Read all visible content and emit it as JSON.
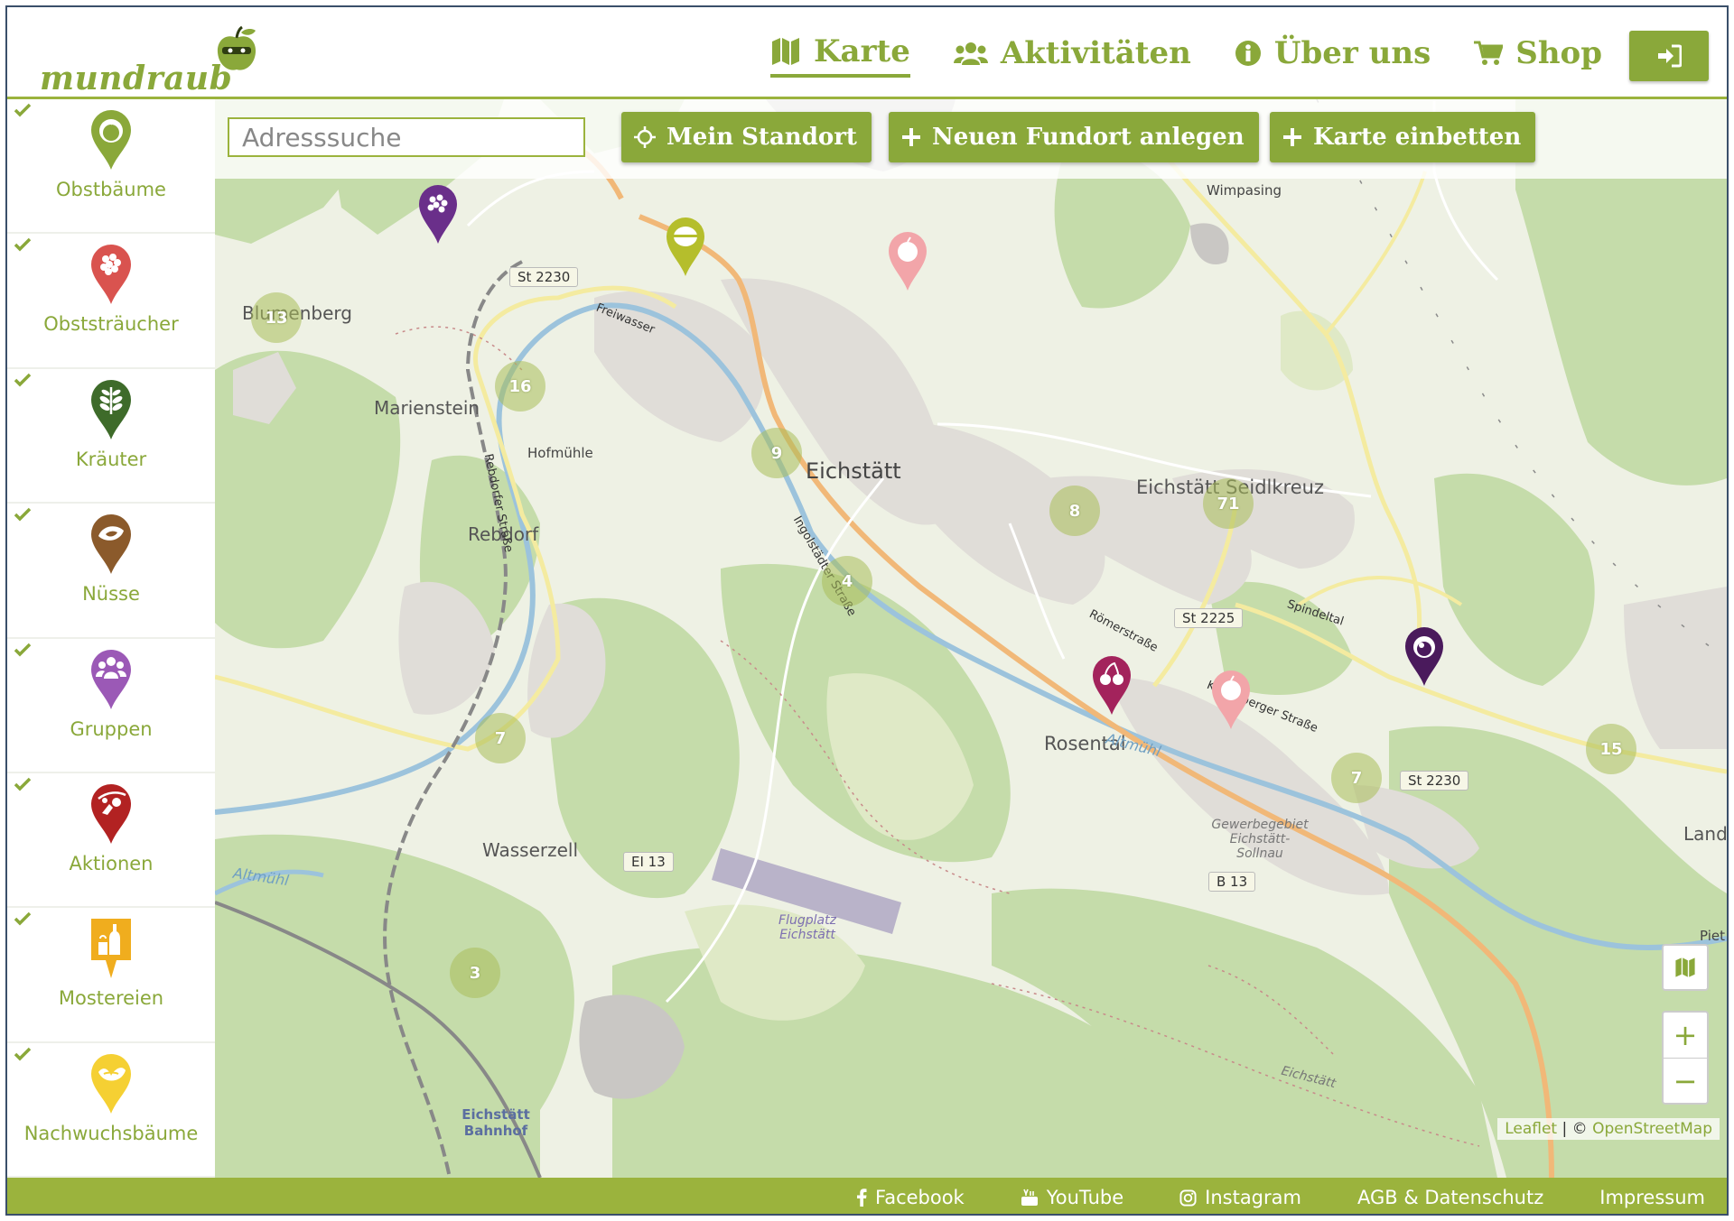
{
  "brand": {
    "name": "mundraub",
    "color": "#8aa83a"
  },
  "nav": {
    "items": [
      {
        "label": "Karte",
        "icon": "map-icon",
        "active": true
      },
      {
        "label": "Aktivitäten",
        "icon": "users-icon",
        "active": false
      },
      {
        "label": "Über uns",
        "icon": "info-icon",
        "active": false
      },
      {
        "label": "Shop",
        "icon": "cart-icon",
        "active": false
      }
    ],
    "login_icon": "sign-in-icon"
  },
  "toolbar": {
    "search_placeholder": "Adresssuche",
    "location_button": "Mein Standort",
    "new_site_button": "Neuen Fundort anlegen",
    "embed_button": "Karte einbetten"
  },
  "sidebar": {
    "categories": [
      {
        "label": "Obstbäume",
        "color": "#8aa83a",
        "icon": "apple-tree-icon",
        "checked": true
      },
      {
        "label": "Obststräucher",
        "color": "#d9534f",
        "icon": "berry-icon",
        "checked": true
      },
      {
        "label": "Kräuter",
        "color": "#3e6b2a",
        "icon": "herb-icon",
        "checked": true
      },
      {
        "label": "Nüsse",
        "color": "#8b5a2b",
        "icon": "nut-icon",
        "checked": true
      },
      {
        "label": "Gruppen",
        "color": "#9b59b6",
        "icon": "group-icon",
        "checked": true
      },
      {
        "label": "Aktionen",
        "color": "#b22222",
        "icon": "action-icon",
        "checked": true
      },
      {
        "label": "Mostereien",
        "color": "#f0ad1e",
        "icon": "bottle-icon",
        "checked": true
      },
      {
        "label": "Nachwuchsbäume",
        "color": "#f5d033",
        "icon": "sprout-icon",
        "checked": true
      }
    ]
  },
  "map": {
    "places": {
      "eichstaett": "Eichstätt",
      "seidlkreuz": "Eichstätt Seidlkreuz",
      "marienstein": "Marienstein",
      "rebdorf": "Rebdorf",
      "blumenberg": "Blumenberg",
      "hofmuehle": "Hofmühle",
      "wasserzell": "Wasserzell",
      "rosental": "Rosental",
      "wimpasing": "Wimpasing",
      "gewerbe": "Gewerbegebiet Eichstätt-Sollnau",
      "flugplatz": "Flugplatz Eichstätt",
      "bahnhof": "Eichstätt Bahnhof",
      "altmuehl": "Altmühl",
      "altmuehl2": "Altmühl",
      "land": "Land",
      "piet": "Piet",
      "rebdorfer": "Rebdorfer Straße",
      "ingolstaedter": "Ingolstädter Straße",
      "roemer": "Römerstraße",
      "spindeltal": "Spindeltal",
      "freiwasser": "Freiwasser",
      "kipfenberger": "Kipfenberger Straße",
      "eichstaett_rail": "Eichstätt"
    },
    "roads": {
      "st2230a": "St 2230",
      "st2225": "St 2225",
      "st2230b": "St 2230",
      "ei13": "EI 13",
      "b13": "B 13"
    },
    "clusters": [
      {
        "count": "13"
      },
      {
        "count": "16"
      },
      {
        "count": "9"
      },
      {
        "count": "8"
      },
      {
        "count": "71"
      },
      {
        "count": "4"
      },
      {
        "count": "7"
      },
      {
        "count": "7"
      },
      {
        "count": "15"
      },
      {
        "count": "3"
      }
    ],
    "attribution": {
      "leaflet": "Leaflet",
      "sep": " | © ",
      "osm": "OpenStreetMap"
    },
    "zoom_in": "+",
    "zoom_out": "−"
  },
  "footer": {
    "links": [
      {
        "label": "Facebook",
        "icon": "facebook-icon"
      },
      {
        "label": "YouTube",
        "icon": "youtube-icon"
      },
      {
        "label": "Instagram",
        "icon": "instagram-icon"
      },
      {
        "label": "AGB & Datenschutz"
      },
      {
        "label": "Impressum"
      }
    ]
  }
}
